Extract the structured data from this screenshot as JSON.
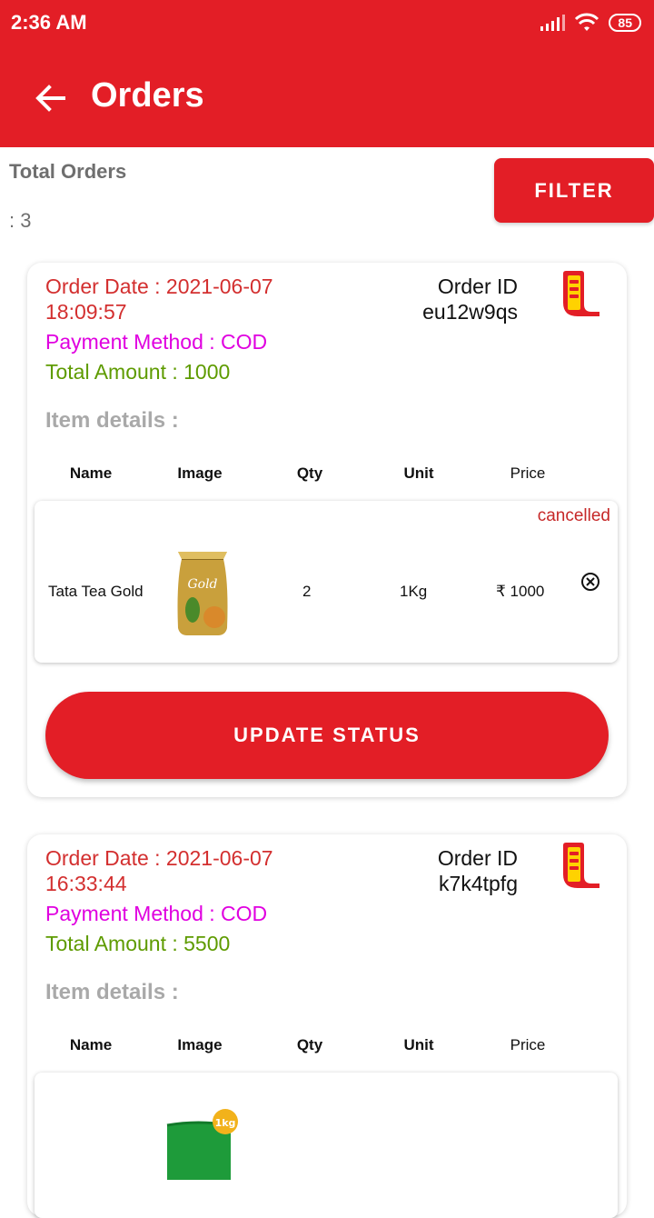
{
  "status_bar": {
    "time": "2:36 AM",
    "battery": "85"
  },
  "app_bar": {
    "title": "Orders"
  },
  "summary": {
    "label": "Total Orders",
    "count": ": 3"
  },
  "filter_label": "FILTER",
  "table_headers": {
    "name": "Name",
    "image": "Image",
    "qty": "Qty",
    "unit": "Unit",
    "price": "Price"
  },
  "orders": [
    {
      "order_date_line1": "Order Date : 2021-06-07",
      "order_date_line2": "18:09:57",
      "payment_method": "Payment Method : COD",
      "total_amount": "Total Amount : 1000",
      "order_id_label": "Order ID",
      "order_id": "eu12w9qs",
      "items_label": "Item details :",
      "item": {
        "status": "cancelled",
        "name": "Tata Tea Gold",
        "qty": "2",
        "unit": "1Kg",
        "price": "₹ 1000",
        "image_label": "Gold"
      },
      "update_label": "UPDATE STATUS"
    },
    {
      "order_date_line1": "Order Date : 2021-06-07",
      "order_date_line2": "16:33:44",
      "payment_method": "Payment Method : COD",
      "total_amount": "Total Amount : 5500",
      "order_id_label": "Order ID",
      "order_id": "k7k4tpfg",
      "items_label": "Item details :",
      "item": {
        "image_label": "1kg"
      }
    }
  ],
  "colors": {
    "primary": "#E31E26",
    "date": "#D32F2F",
    "payment": "#E000E0",
    "amount": "#5E9B00",
    "muted": "#6f6f6f"
  }
}
